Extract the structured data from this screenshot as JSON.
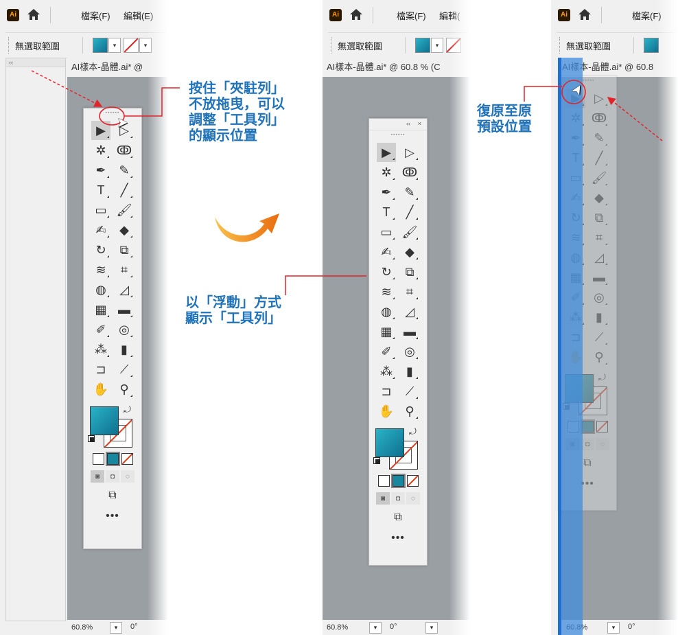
{
  "menubar": {
    "app_icon": "Ai",
    "home_icon": "home-icon",
    "file": "檔案(F)",
    "edit": "編輯(E)",
    "edit_cut": "編輯("
  },
  "controlbar": {
    "selection_label": "無選取範圍"
  },
  "document": {
    "tab1": "AI樣本-晶體.ai* @",
    "tab2": "AI樣本-晶體.ai* @ 60.8 % (C",
    "tab3": "AI樣本-晶體.ai* @ 60.8"
  },
  "status": {
    "zoom": "60.8%",
    "rotation": "0°"
  },
  "panel_header": {
    "collapse": "‹‹",
    "close": "×"
  },
  "toolbar": {
    "tools": [
      "selection-tool",
      "direct-selection-tool",
      "magic-wand-tool",
      "lasso-tool",
      "pen-tool",
      "curvature-tool",
      "type-tool",
      "line-segment-tool",
      "rectangle-tool",
      "paintbrush-tool",
      "shaper-tool",
      "eraser-tool",
      "rotate-tool",
      "scale-tool",
      "width-tool",
      "free-transform-tool",
      "shape-builder-tool",
      "perspective-grid-tool",
      "mesh-tool",
      "gradient-tool",
      "eyedropper-tool",
      "blend-tool",
      "symbol-sprayer-tool",
      "column-graph-tool",
      "artboard-tool",
      "slice-tool",
      "hand-tool",
      "zoom-tool"
    ],
    "more": "•••"
  },
  "annotations": {
    "a1": "按住「夾駐列」",
    "a2": "不放拖曳，可以",
    "a3": "調整「工具列」",
    "a4": "的顯示位置",
    "b1": "以「浮動」方式",
    "b2": "顯示「工具列」",
    "c1": "復原至原",
    "c2": "預設位置"
  },
  "colors": {
    "accent": "#2073b8",
    "callout_red": "#e2232a",
    "fill": "#19879f",
    "canvas": "#9a9fa3",
    "dock_blue": "#1e6fcf",
    "arrow_orange": "#f39a1b"
  }
}
